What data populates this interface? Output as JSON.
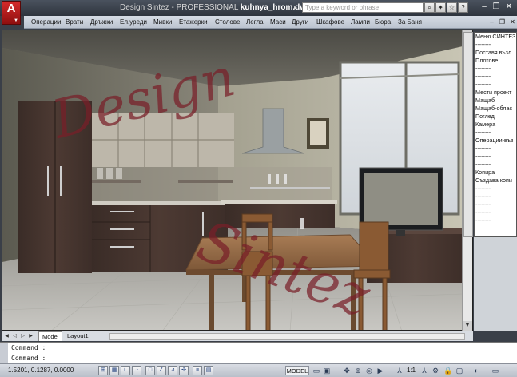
{
  "app": {
    "logo_letter": "A",
    "title_prefix": "Design Sintez - PROFESSIONAL",
    "file_name": "kuhnya_hrom.dwg"
  },
  "search": {
    "placeholder": "Type a keyword or phrase"
  },
  "menu": {
    "items": [
      "Операции",
      "Врати",
      "Дръжки",
      "Ел.уреди",
      "Мивки",
      "Етажерки",
      "Столове",
      "Легла",
      "Маси",
      "Други",
      "Шкафове",
      "Лампи",
      "Бюра",
      "За Баня"
    ]
  },
  "watermark": {
    "line1": "Design",
    "line2": "Sintez"
  },
  "side_panel": {
    "items": [
      "Меню СИНТЕЗ",
      "--------",
      "Поставя възл",
      "Плотове",
      "--------",
      "--------",
      "--------",
      "Мести проект",
      "Мащаб",
      "Мащаб-облас",
      "Поглед",
      "Камера",
      "--------",
      "Операции-въз",
      "--------",
      "--------",
      "--------",
      "Копира",
      "Създава копи",
      "--------",
      "--------",
      "--------",
      "--------",
      "--------"
    ]
  },
  "layout_tabs": {
    "items": [
      "Model",
      "Layout1"
    ],
    "active": "Model"
  },
  "command": {
    "lines": [
      "Command :",
      "Command :"
    ]
  },
  "status": {
    "coordinates": "1.5201, 0.1287, 0.0000",
    "model_label": "MODEL",
    "scale": "1:1"
  },
  "colors": {
    "accent": "#c62828",
    "watermark": "#7a1e28",
    "menubar": "#c8cfd9"
  },
  "icons": {
    "toggle_icons": [
      "snap-icon",
      "grid-icon",
      "ortho-icon",
      "polar-icon",
      "osnap-icon",
      "otrack-icon",
      "ducs-icon",
      "dyn-icon",
      "lwt-icon",
      "qp-icon"
    ],
    "status_icons": [
      "quick-view-layouts-icon",
      "quick-view-drawings-icon",
      "pan-icon",
      "zoom-icon",
      "steering-wheel-icon",
      "showmotion-icon",
      "annotation-scale-icon",
      "annotation-visibility-icon",
      "workspace-icon",
      "lock-icon",
      "hardware-acceleration-icon",
      "isolate-icon",
      "clean-screen-icon"
    ]
  }
}
